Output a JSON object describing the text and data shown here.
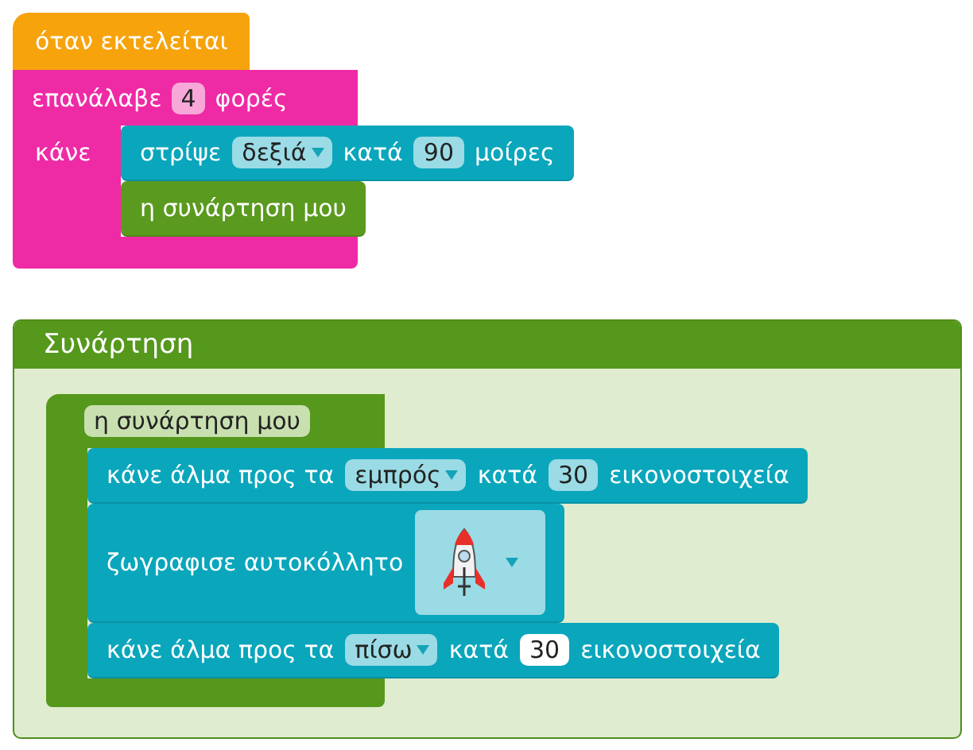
{
  "script": {
    "hat": {
      "label": "όταν εκτελείται"
    },
    "repeat": {
      "parts": [
        {
          "kind": "text",
          "text": "επανάλαβε"
        },
        {
          "kind": "number",
          "text": "4",
          "editing": false
        },
        {
          "kind": "text",
          "text": "φορές"
        }
      ],
      "do_label": "κάνε",
      "blocks": [
        {
          "kind": "turn",
          "parts": [
            {
              "kind": "text",
              "text": "στρίψε"
            },
            {
              "kind": "dropdown",
              "text": "δεξιά"
            },
            {
              "kind": "text",
              "text": "κατά"
            },
            {
              "kind": "number",
              "text": "90",
              "editing": false
            },
            {
              "kind": "text",
              "text": "μοίρες"
            }
          ]
        },
        {
          "kind": "call",
          "parts": [
            {
              "kind": "text",
              "text": "η συνάρτηση μου"
            }
          ]
        }
      ]
    }
  },
  "function_panel": {
    "title": "Συνάρτηση",
    "definition": {
      "name": "η συνάρτηση μου",
      "blocks": [
        {
          "kind": "jump",
          "parts": [
            {
              "kind": "text",
              "text": "κάνε άλμα προς τα"
            },
            {
              "kind": "dropdown",
              "text": "εμπρός"
            },
            {
              "kind": "text",
              "text": "κατά"
            },
            {
              "kind": "number",
              "text": "30",
              "editing": false
            },
            {
              "kind": "text",
              "text": "εικονοστοιχεία"
            }
          ]
        },
        {
          "kind": "sticker",
          "parts": [
            {
              "kind": "text",
              "text": "ζωγραφισε αυτοκόλλητο"
            },
            {
              "kind": "sticker"
            }
          ]
        },
        {
          "kind": "jump",
          "parts": [
            {
              "kind": "text",
              "text": "κάνε άλμα προς τα"
            },
            {
              "kind": "dropdown",
              "text": "πίσω"
            },
            {
              "kind": "text",
              "text": "κατά"
            },
            {
              "kind": "number",
              "text": "30",
              "editing": true
            },
            {
              "kind": "text",
              "text": "εικονοστοιχεία"
            }
          ]
        }
      ]
    }
  }
}
